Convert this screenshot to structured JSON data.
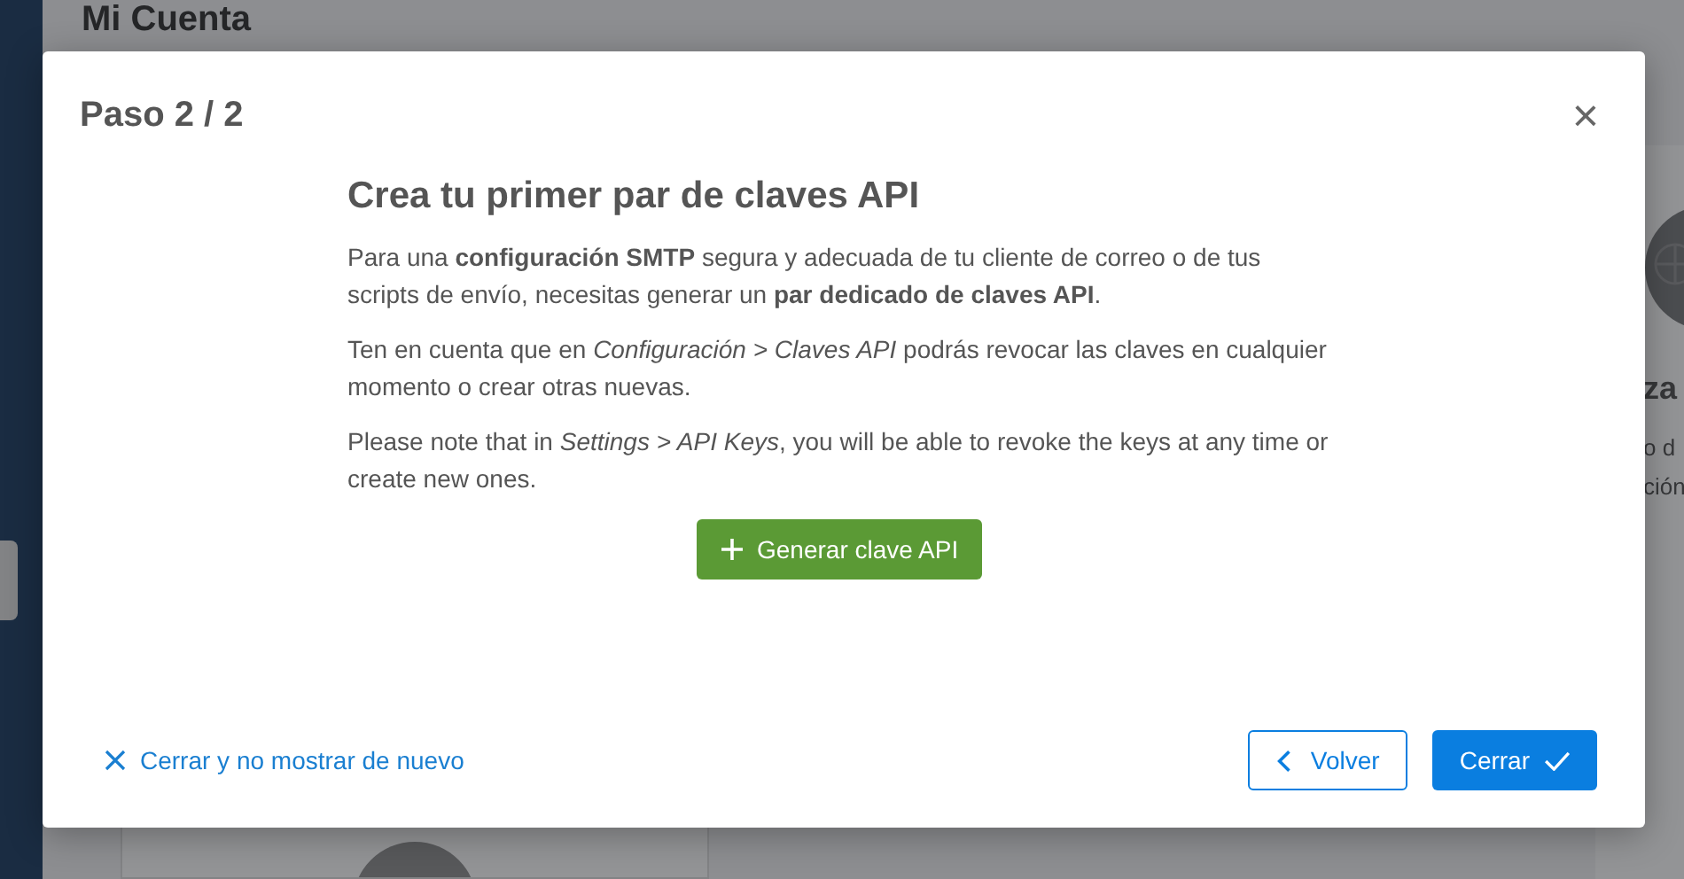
{
  "page": {
    "title": "Mi Cuenta",
    "side_fragments": [
      "za",
      "o d",
      "ción"
    ]
  },
  "dialog": {
    "title": "Paso 2 / 2",
    "close": "×",
    "heading": "Crea tu primer par de claves API",
    "paragraphs": [
      "Para una **configuración SMTP** segura y adecuada de tu cliente de correo o de tus scripts de envío, necesitas generar un **par dedicado de claves API**.",
      "Ten en cuenta que en *Configuración > Claves API* podrás revocar las claves en cualquier momento o crear otras nuevas.",
      "Please note that in *Settings > API Keys*, you will be able to revoke the keys at any time or create new ones."
    ],
    "generate_button": "Generar clave API",
    "dismiss_link": "Cerrar y no mostrar de nuevo",
    "back_button": "Volver",
    "close_button": "Cerrar"
  }
}
